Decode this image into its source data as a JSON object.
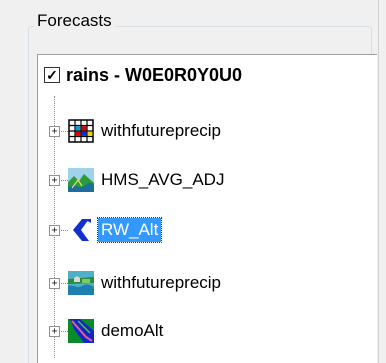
{
  "group": {
    "title": "Forecasts"
  },
  "root": {
    "checked_glyph": "✓",
    "label": "rains - W0E0R0Y0U0"
  },
  "tree": {
    "expander_glyph": "+",
    "items": [
      {
        "label": "withfutureprecip",
        "icon": "grid-icon",
        "selected": false
      },
      {
        "label": "HMS_AVG_ADJ",
        "icon": "hms-icon",
        "selected": false
      },
      {
        "label": "RW_Alt",
        "icon": "resweight-icon",
        "selected": true
      },
      {
        "label": "withfutureprecip",
        "icon": "flood-icon",
        "selected": false
      },
      {
        "label": "demoAlt",
        "icon": "river-map-icon",
        "selected": false
      }
    ]
  }
}
